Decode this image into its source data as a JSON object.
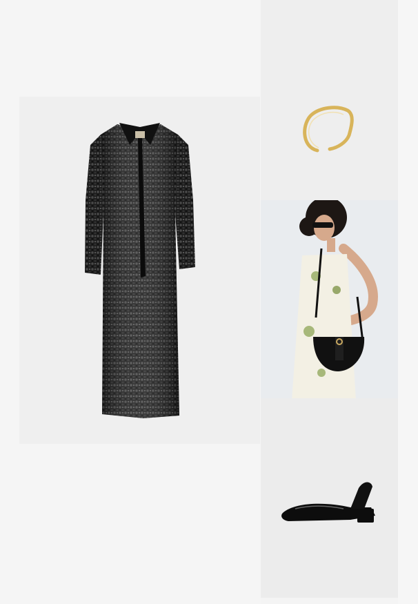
{
  "products": [
    {
      "id": "sequin-coat",
      "icon": "sequin-coat-image"
    },
    {
      "id": "gold-ring",
      "icon": "gold-ring-image"
    },
    {
      "id": "model-bag",
      "icon": "model-with-black-bag-image"
    },
    {
      "id": "patent-heels",
      "icon": "black-patent-slingback-heel-image"
    }
  ],
  "colors": {
    "background": "#f4f4f4",
    "panel": "#efefef",
    "sequin": "#1a1a1a",
    "gold": "#d8b45a",
    "patent": "#0d0d0d"
  }
}
